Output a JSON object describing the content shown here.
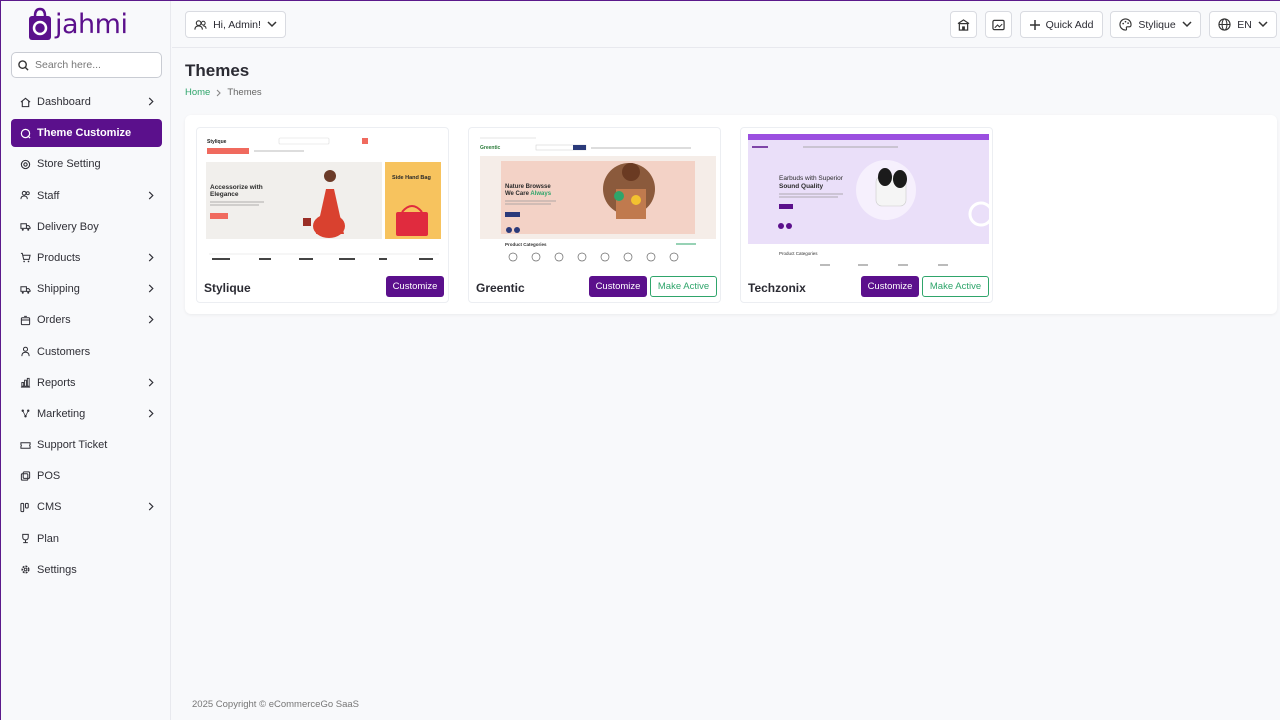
{
  "brand": {
    "name": "jahmi",
    "color": "#5b108c"
  },
  "search": {
    "placeholder": "Search here..."
  },
  "sidebar": {
    "items": [
      {
        "label": "Dashboard",
        "icon": "home-icon",
        "chevron": true
      },
      {
        "label": "Theme Customize",
        "icon": "theme-icon",
        "chevron": false,
        "active": true
      },
      {
        "label": "Store Setting",
        "icon": "settings-icon",
        "chevron": false
      },
      {
        "label": "Staff",
        "icon": "users-icon",
        "chevron": true
      },
      {
        "label": "Delivery Boy",
        "icon": "truck-icon",
        "chevron": false
      },
      {
        "label": "Products",
        "icon": "cart-icon",
        "chevron": true
      },
      {
        "label": "Shipping",
        "icon": "truck-icon",
        "chevron": true
      },
      {
        "label": "Orders",
        "icon": "box-icon",
        "chevron": true
      },
      {
        "label": "Customers",
        "icon": "user-icon",
        "chevron": false
      },
      {
        "label": "Reports",
        "icon": "chart-icon",
        "chevron": true
      },
      {
        "label": "Marketing",
        "icon": "marketing-icon",
        "chevron": true
      },
      {
        "label": "Support Ticket",
        "icon": "ticket-icon",
        "chevron": false
      },
      {
        "label": "POS",
        "icon": "pos-icon",
        "chevron": false
      },
      {
        "label": "CMS",
        "icon": "cms-icon",
        "chevron": true
      },
      {
        "label": "Plan",
        "icon": "trophy-icon",
        "chevron": false
      },
      {
        "label": "Settings",
        "icon": "gear-icon",
        "chevron": false
      }
    ]
  },
  "topbar": {
    "greeting": "Hi, Admin!",
    "quick_add": "Quick Add",
    "theme_select": "Stylique",
    "language": "EN"
  },
  "page": {
    "title": "Themes",
    "breadcrumb": {
      "home": "Home",
      "current": "Themes"
    }
  },
  "themes": [
    {
      "name": "Stylique",
      "customize": "Customize",
      "make_active": "",
      "preview": {
        "logo": "Stylique",
        "hero_title_1": "Accessorize with",
        "hero_title_2": "Elegance",
        "side_title": "Side Hand Bag"
      }
    },
    {
      "name": "Greentic",
      "customize": "Customize",
      "make_active": "Make Active",
      "preview": {
        "logo": "Greentic",
        "hero_title_1": "Nature Browsse",
        "hero_title_2": "We Care",
        "hero_accent": "Always",
        "section": "Product Categories"
      }
    },
    {
      "name": "Techzonix",
      "customize": "Customize",
      "make_active": "Make Active",
      "preview": {
        "hero_title_1": "Earbuds with Superior",
        "hero_title_2": "Sound Quality",
        "section": "Product Categories"
      }
    }
  ],
  "footer": {
    "copyright": "2025 Copyright © eCommerceGo SaaS"
  },
  "colors": {
    "primary": "#5b108c",
    "success": "#2fa56b"
  }
}
